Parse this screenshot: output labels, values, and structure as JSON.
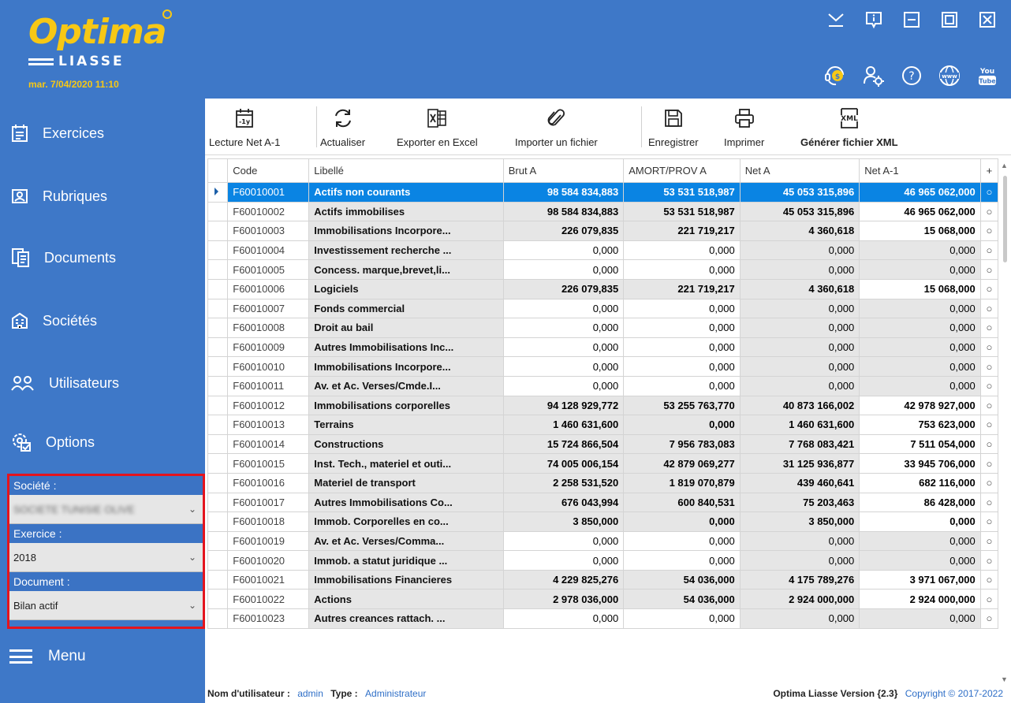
{
  "app": {
    "logo_main": "Optima",
    "logo_sub": "LIASSE",
    "datetime": "mar. 7/04/2020 11:10"
  },
  "window_icons": [
    "minimize-to-tray-icon",
    "info-icon",
    "minimize-icon",
    "maximize-icon",
    "close-icon"
  ],
  "app_icons": [
    "support-icon",
    "user-settings-icon",
    "help-icon",
    "www-icon",
    "youtube-icon"
  ],
  "app_icon_text": {
    "youtube": "You\nTube",
    "www": "www"
  },
  "sidebar": {
    "items": [
      {
        "label": "Exercices",
        "icon": "calendar-list-icon"
      },
      {
        "label": "Rubriques",
        "icon": "contact-card-icon"
      },
      {
        "label": "Documents",
        "icon": "documents-icon"
      },
      {
        "label": "Sociétés",
        "icon": "building-icon"
      },
      {
        "label": "Utilisateurs",
        "icon": "users-icon"
      },
      {
        "label": "Options",
        "icon": "options-icon"
      }
    ],
    "filters": {
      "societe_label": "Société :",
      "societe_value": "SOCIETE TUNISIE OLIVE",
      "exercice_label": "Exercice :",
      "exercice_value": "2018",
      "document_label": "Document :",
      "document_value": "Bilan actif"
    },
    "menu_label": "Menu"
  },
  "toolbar": {
    "lecture": "Lecture Net A-1",
    "lecture_icon_text": "-1y",
    "actualiser": "Actualiser",
    "exporter": "Exporter en Excel",
    "importer": "Importer un fichier",
    "enregistrer": "Enregistrer",
    "imprimer": "Imprimer",
    "xml": "Générer fichier XML",
    "xml_icon_text": "XML"
  },
  "grid": {
    "headers": [
      "Code",
      "Libellé",
      "Brut A",
      "AMORT/PROV A",
      "Net A",
      "Net A-1",
      "+"
    ],
    "rows": [
      [
        "F60010001",
        "Actifs non courants",
        "98 584 834,883",
        "53 531 518,987",
        "45 053 315,896",
        "46 965 062,000"
      ],
      [
        "F60010002",
        "Actifs immobilises",
        "98 584 834,883",
        "53 531 518,987",
        "45 053 315,896",
        "46 965 062,000"
      ],
      [
        "F60010003",
        "Immobilisations Incorpore...",
        "226 079,835",
        "221 719,217",
        "4 360,618",
        "15 068,000"
      ],
      [
        "F60010004",
        "Investissement recherche ...",
        "0,000",
        "0,000",
        "0,000",
        "0,000"
      ],
      [
        "F60010005",
        "Concess. marque,brevet,li...",
        "0,000",
        "0,000",
        "0,000",
        "0,000"
      ],
      [
        "F60010006",
        "Logiciels",
        "226 079,835",
        "221 719,217",
        "4 360,618",
        "15 068,000"
      ],
      [
        "F60010007",
        "Fonds commercial",
        "0,000",
        "0,000",
        "0,000",
        "0,000"
      ],
      [
        "F60010008",
        "Droit au bail",
        "0,000",
        "0,000",
        "0,000",
        "0,000"
      ],
      [
        "F60010009",
        "Autres Immobilisations Inc...",
        "0,000",
        "0,000",
        "0,000",
        "0,000"
      ],
      [
        "F60010010",
        "Immobilisations Incorpore...",
        "0,000",
        "0,000",
        "0,000",
        "0,000"
      ],
      [
        "F60010011",
        "Av. et Ac. Verses/Cmde.I...",
        "0,000",
        "0,000",
        "0,000",
        "0,000"
      ],
      [
        "F60010012",
        "Immobilisations corporelles",
        "94 128 929,772",
        "53 255 763,770",
        "40 873 166,002",
        "42 978 927,000"
      ],
      [
        "F60010013",
        "Terrains",
        "1 460 631,600",
        "0,000",
        "1 460 631,600",
        "753 623,000"
      ],
      [
        "F60010014",
        "Constructions",
        "15 724 866,504",
        "7 956 783,083",
        "7 768 083,421",
        "7 511 054,000"
      ],
      [
        "F60010015",
        "Inst. Tech., materiel et outi...",
        "74 005 006,154",
        "42 879 069,277",
        "31 125 936,877",
        "33 945 706,000"
      ],
      [
        "F60010016",
        "Materiel de transport",
        "2 258 531,520",
        "1 819 070,879",
        "439 460,641",
        "682 116,000"
      ],
      [
        "F60010017",
        "Autres Immobilisations Co...",
        "676 043,994",
        "600 840,531",
        "75 203,463",
        "86 428,000"
      ],
      [
        "F60010018",
        "Immob. Corporelles en co...",
        "3 850,000",
        "0,000",
        "3 850,000",
        "0,000"
      ],
      [
        "F60010019",
        "Av. et Ac. Verses/Comma...",
        "0,000",
        "0,000",
        "0,000",
        "0,000"
      ],
      [
        "F60010020",
        "Immob. a statut juridique ...",
        "0,000",
        "0,000",
        "0,000",
        "0,000"
      ],
      [
        "F60010021",
        "Immobilisations Financieres",
        "4 229 825,276",
        "54 036,000",
        "4 175 789,276",
        "3 971 067,000"
      ],
      [
        "F60010022",
        "Actions",
        "2 978 036,000",
        "54 036,000",
        "2 924 000,000",
        "2 924 000,000"
      ],
      [
        "F60010023",
        "Autres creances rattach. ...",
        "0,000",
        "0,000",
        "0,000",
        "0,000"
      ]
    ],
    "selected_row": 0,
    "radio_glyph": "○"
  },
  "status": {
    "user_label": "Nom d'utilisateur :",
    "user_value": "admin",
    "type_label": "Type :",
    "type_value": "Administrateur",
    "version": "Optima Liasse Version {2.3}",
    "copyright": "Copyright © 2017-2022"
  },
  "colors": {
    "sidebar_bg": "#3e78c8",
    "accent_yellow": "#f7c815",
    "selection_blue": "#0a84e3",
    "filter_border_red": "#e4141e"
  }
}
